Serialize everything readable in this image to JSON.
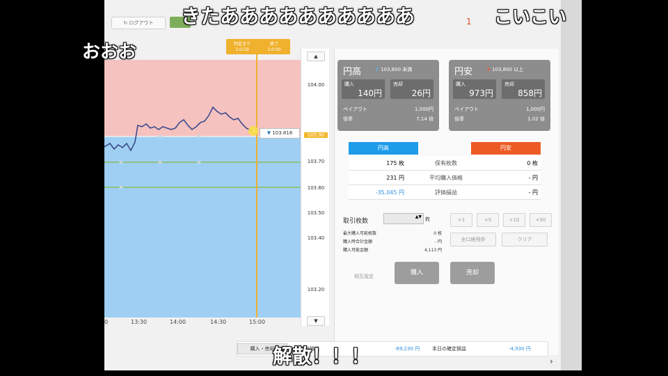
{
  "topbar": {
    "logout": "ログアウト",
    "indicator": "1",
    "green_label": ""
  },
  "chart": {
    "ticks": [
      "104.00",
      "103.90",
      "103.70",
      "103.60",
      "103.50",
      "103.40",
      "103.20"
    ],
    "time_labels": [
      "13:30",
      "14:00",
      "14:30",
      "15:00"
    ],
    "time_left": "0",
    "current_price": "103.816",
    "tag": {
      "left_top": "判定まで",
      "left_bottom": "1:0:59",
      "right_top": "終了",
      "right_bottom": "1:0:00"
    },
    "colors": {
      "upper_zone": "#f5c2c0",
      "lower_zone": "#9fd0f3",
      "line": "#3b4a8a",
      "cursor": "#f0b12e",
      "guide": "#8bbd5b"
    }
  },
  "cards": {
    "yen_high": {
      "title": "円高",
      "condition": "103,800 未満",
      "buy_label": "購入",
      "buy_value": "140円",
      "sell_label": "売却",
      "sell_value": "26円",
      "payout_label": "ペイアウト",
      "payout_value": "1,000円",
      "ratio_label": "倍率",
      "ratio_value": "7.14 倍"
    },
    "yen_low": {
      "title": "円安",
      "condition": "103,800 以上",
      "buy_label": "購入",
      "buy_value": "973円",
      "sell_label": "売却",
      "sell_value": "858円",
      "payout_label": "ペイアウト",
      "payout_value": "1,000円",
      "ratio_label": "倍率",
      "ratio_value": "1.02 倍"
    }
  },
  "positions": {
    "head_high": "円高",
    "head_low": "円安",
    "rows": [
      {
        "left": "175 枚",
        "label": "保有枚数",
        "right": "0 枚"
      },
      {
        "left": "231 円",
        "label": "平均購入価格",
        "right": "- 円"
      },
      {
        "left": "-35,045 円",
        "label": "評価損益",
        "right": "- 円"
      }
    ]
  },
  "trade": {
    "lot_label": "取引枚数",
    "lot_unit": "枚",
    "buttons": [
      "+1",
      "+5",
      "+10",
      "+50"
    ],
    "max_buy": "全口座残存",
    "clear": "クリア",
    "info": [
      {
        "label": "最大購入可能枚数",
        "value": "0 枚"
      },
      {
        "label": "購入時合計金額",
        "value": "- 円"
      },
      {
        "label": "購入可能金額",
        "value": "4,113 円"
      }
    ],
    "reset": "相互設定",
    "buy": "購入",
    "sell": "売却"
  },
  "summary": {
    "button": "購入・売却",
    "label1": "合計損益",
    "value1": "-69,230 円",
    "label2": "本日の確定損益",
    "value2": "-4,930 円"
  },
  "comments": {
    "c1": "きたああああああああああ",
    "c2": "おおお",
    "c3": "こいこい",
    "c4": "解散！！！"
  }
}
